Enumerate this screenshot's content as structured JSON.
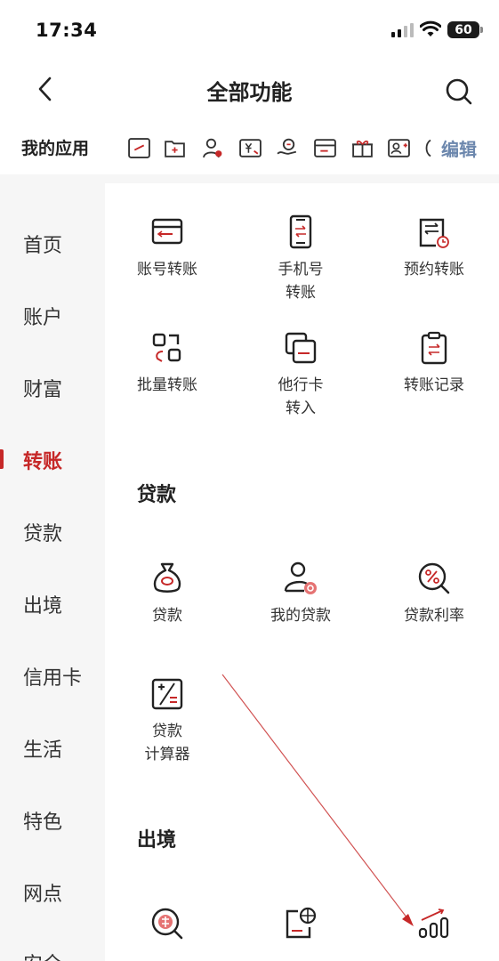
{
  "status_bar": {
    "time": "17:34",
    "battery": "60"
  },
  "nav": {
    "title": "全部功能"
  },
  "my_apps": {
    "label": "我的应用",
    "edit": "编辑"
  },
  "sidebar": {
    "items": [
      "首页",
      "账户",
      "财富",
      "转账",
      "贷款",
      "出境",
      "信用卡",
      "生活",
      "特色",
      "网点",
      "安全"
    ],
    "active": "转账"
  },
  "transfer": {
    "items": [
      {
        "label": "账号转账",
        "icon": "card-transfer-icon"
      },
      {
        "label": "手机号\n转账",
        "icon": "phone-transfer-icon"
      },
      {
        "label": "预约转账",
        "icon": "scheduled-transfer-icon"
      },
      {
        "label": "批量转账",
        "icon": "batch-transfer-icon"
      },
      {
        "label": "他行卡\n转入",
        "icon": "other-bank-card-icon"
      },
      {
        "label": "转账记录",
        "icon": "transfer-record-icon"
      }
    ]
  },
  "loan": {
    "title": "贷款",
    "items": [
      {
        "label": "贷款",
        "icon": "money-bag-icon"
      },
      {
        "label": "我的贷款",
        "icon": "my-loan-icon"
      },
      {
        "label": "贷款利率",
        "icon": "loan-rate-icon"
      },
      {
        "label": "贷款\n计算器",
        "icon": "loan-calculator-icon"
      }
    ]
  },
  "abroad": {
    "title": "出境",
    "items": [
      {
        "label": "",
        "icon": "exchange-icon"
      },
      {
        "label": "",
        "icon": "global-card-icon"
      },
      {
        "label": "",
        "icon": "rate-chart-icon"
      }
    ]
  },
  "colors": {
    "accent": "#c62828",
    "edit": "#6c87ad",
    "sidebar_bg": "#f6f6f6"
  }
}
